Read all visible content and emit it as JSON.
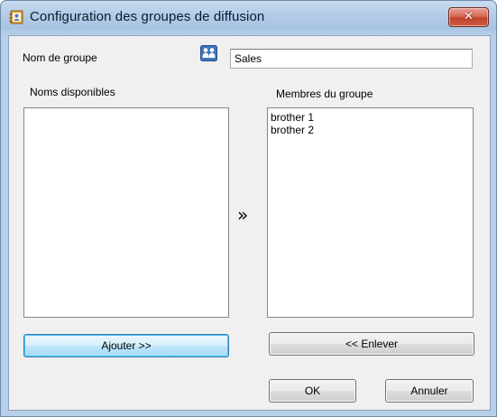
{
  "window": {
    "title": "Configuration des groupes de diffusion",
    "close_symbol": "✕",
    "title_icon": "address-book-icon"
  },
  "form": {
    "group_name_label": "Nom de groupe",
    "group_icon": "group-people-icon",
    "group_name_value": "Sales"
  },
  "available": {
    "label": "Noms disponibles",
    "items": []
  },
  "members": {
    "label": "Membres du groupe",
    "items": [
      "brother 1",
      "brother 2"
    ]
  },
  "transfer_symbol": "»",
  "buttons": {
    "add": "Ajouter >>",
    "remove": "<< Enlever",
    "ok": "OK",
    "cancel": "Annuler"
  },
  "colors": {
    "close_button": "#c2432c",
    "focused_button": "#3c7fb1",
    "title_bar": "#b4cde8"
  }
}
